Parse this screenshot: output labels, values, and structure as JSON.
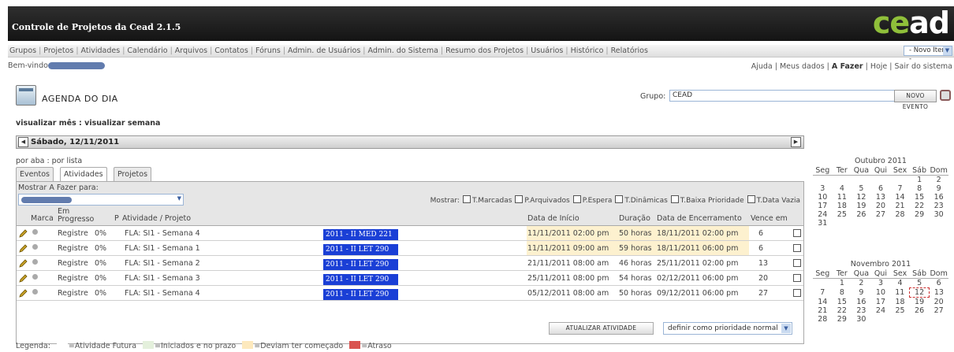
{
  "app": {
    "title": "Controle de Projetos da Cead 2.1.5",
    "logo_a": "ce",
    "logo_b": "ad"
  },
  "menu": {
    "items": [
      "Grupos",
      "Projetos",
      "Atividades",
      "Calendário",
      "Arquivos",
      "Contatos",
      "Fóruns",
      "Admin. de Usuários",
      "Admin. do Sistema",
      "Resumo dos Projetos",
      "Usuários",
      "Histórico",
      "Relatórios"
    ],
    "new_item": "- Novo Item -"
  },
  "header": {
    "welcome": "Bem-vindo",
    "links": [
      "Ajuda",
      "Meus dados",
      "A Fazer",
      "Hoje",
      "Sair do sistema"
    ]
  },
  "agenda": {
    "title": "AGENDA DO DIA",
    "grupo_label": "Grupo:",
    "grupo_value": "CEAD",
    "novo_evento": "NOVO EVENTO",
    "views": "visualizar mês : visualizar semana",
    "date": "Sábado, 12/11/2011",
    "modes": "por aba : por lista"
  },
  "tabs": [
    "Eventos",
    "Atividades",
    "Projetos"
  ],
  "filters": {
    "mostrar_para": "Mostrar A Fazer para:",
    "mostrar": "Mostrar:",
    "options": [
      "T.Marcadas",
      "P.Arquivados",
      "P.Espera",
      "T.Dinâmicas",
      "T.Baixa Prioridade",
      "T.Data Vazia"
    ]
  },
  "table": {
    "headers": {
      "marca": "Marca",
      "progress": "Em Progresso",
      "p": "P",
      "activity": "Atividade / Projeto",
      "start": "Data de Início",
      "duration": "Duração",
      "end": "Data de Encerramento",
      "due": "Vence em"
    },
    "rows": [
      {
        "status": "Registre",
        "pct": "0%",
        "activity": "FLA: SI1 - Semana 4",
        "project": "2011 - II MED 221",
        "start": "11/11/2011 02:00 pm",
        "duration": "50 horas",
        "end": "18/11/2011 02:00 pm",
        "due": "6",
        "late": true
      },
      {
        "status": "Registre",
        "pct": "0%",
        "activity": "FLA: SI1 - Semana 1",
        "project": "2011 - II LET 290",
        "start": "11/11/2011 09:00 am",
        "duration": "59 horas",
        "end": "18/11/2011 06:00 pm",
        "due": "6",
        "late": true
      },
      {
        "status": "Registre",
        "pct": "0%",
        "activity": "FLA: SI1 - Semana 2",
        "project": "2011 - II LET 290",
        "start": "21/11/2011 08:00 am",
        "duration": "46 horas",
        "end": "25/11/2011 02:00 pm",
        "due": "13",
        "late": false
      },
      {
        "status": "Registre",
        "pct": "0%",
        "activity": "FLA: SI1 - Semana 3",
        "project": "2011 - II LET 290",
        "start": "25/11/2011 08:00 pm",
        "duration": "54 horas",
        "end": "02/12/2011 06:00 pm",
        "due": "20",
        "late": false
      },
      {
        "status": "Registre",
        "pct": "0%",
        "activity": "FLA: SI1 - Semana 4",
        "project": "2011 - II LET 290",
        "start": "05/12/2011 08:00 am",
        "duration": "50 horas",
        "end": "09/12/2011 06:00 pm",
        "due": "27",
        "late": false
      }
    ]
  },
  "actions": {
    "update": "ATUALIZAR ATIVIDADE",
    "priority": "definir como prioridade normal"
  },
  "legend": {
    "label": "Legenda:",
    "items": [
      {
        "text": "=Atividade Futura",
        "color": "#ffffff"
      },
      {
        "text": "=Iniciados e no prazo",
        "color": "#e4f0dc"
      },
      {
        "text": "=Deviam ter começado",
        "color": "#fde9bd"
      },
      {
        "text": "=Atraso",
        "color": "#d9534f"
      }
    ]
  },
  "colors": {
    "late_row": "#fdf1cf",
    "project_tag": "#1a3fd6"
  },
  "calendars": [
    {
      "title": "Outubro 2011",
      "weeks": [
        [
          "",
          "",
          "",
          "",
          "",
          "1",
          "2"
        ],
        [
          "3",
          "4",
          "5",
          "6",
          "7",
          "8",
          "9"
        ],
        [
          "10",
          "11",
          "12",
          "13",
          "14",
          "15",
          "16"
        ],
        [
          "17",
          "18",
          "19",
          "20",
          "21",
          "22",
          "23"
        ],
        [
          "24",
          "25",
          "26",
          "27",
          "28",
          "29",
          "30"
        ],
        [
          "31",
          "",
          "",
          "",
          "",
          "",
          ""
        ]
      ]
    },
    {
      "title": "Novembro 2011",
      "weeks": [
        [
          "",
          "1",
          "2",
          "3",
          "4",
          "5",
          "6"
        ],
        [
          "7",
          "8",
          "9",
          "10",
          "11",
          "12",
          "13"
        ],
        [
          "14",
          "15",
          "16",
          "17",
          "18",
          "19",
          "20"
        ],
        [
          "21",
          "22",
          "23",
          "24",
          "25",
          "26",
          "27"
        ],
        [
          "28",
          "29",
          "30",
          "",
          "",
          "",
          ""
        ]
      ],
      "today": "12"
    }
  ],
  "weekdays": [
    "Seg",
    "Ter",
    "Qua",
    "Qui",
    "Sex",
    "Sáb",
    "Dom"
  ]
}
